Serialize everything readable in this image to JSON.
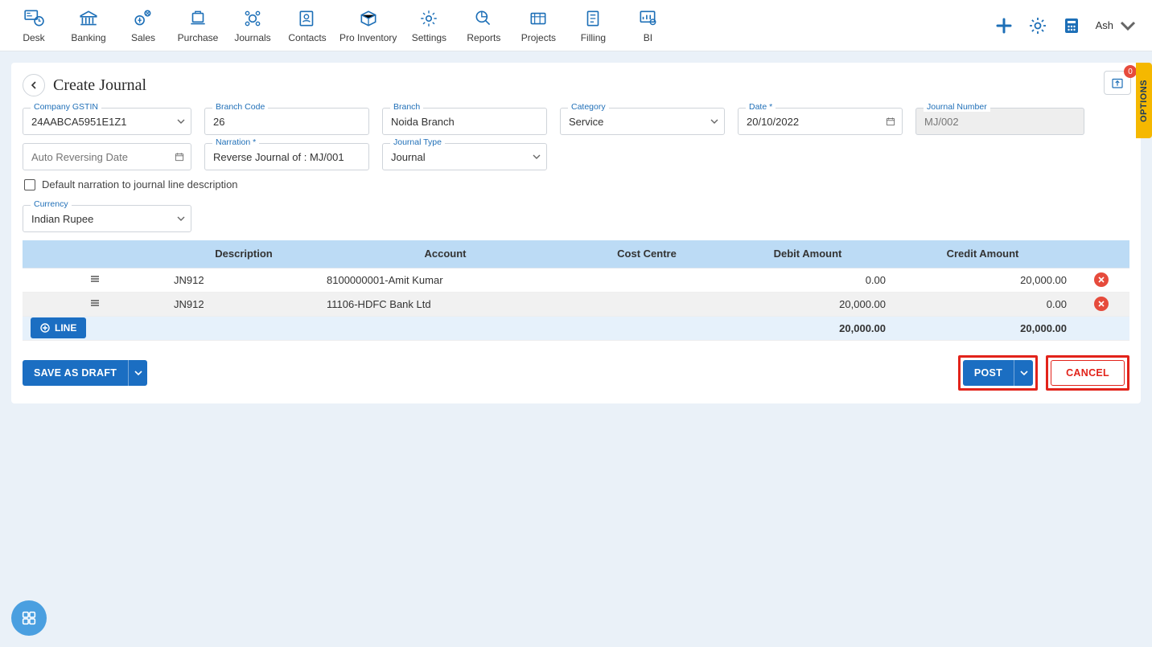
{
  "nav": {
    "items": [
      {
        "label": "Desk",
        "name": "nav-desk"
      },
      {
        "label": "Banking",
        "name": "nav-banking"
      },
      {
        "label": "Sales",
        "name": "nav-sales"
      },
      {
        "label": "Purchase",
        "name": "nav-purchase"
      },
      {
        "label": "Journals",
        "name": "nav-journals"
      },
      {
        "label": "Contacts",
        "name": "nav-contacts"
      },
      {
        "label": "Pro Inventory",
        "name": "nav-pro-inventory"
      },
      {
        "label": "Settings",
        "name": "nav-settings"
      },
      {
        "label": "Reports",
        "name": "nav-reports"
      },
      {
        "label": "Projects",
        "name": "nav-projects"
      },
      {
        "label": "Filling",
        "name": "nav-filling"
      },
      {
        "label": "BI",
        "name": "nav-bi"
      }
    ]
  },
  "user": {
    "name": "Ash"
  },
  "options_tab": "OPTIONS",
  "upload": {
    "badge": "0"
  },
  "page": {
    "title": "Create Journal"
  },
  "form": {
    "company_gstin": {
      "label": "Company GSTIN",
      "value": "24AABCA5951E1Z1"
    },
    "branch_code": {
      "label": "Branch Code",
      "value": "26"
    },
    "branch": {
      "label": "Branch",
      "value": "Noida Branch"
    },
    "category": {
      "label": "Category",
      "value": "Service"
    },
    "date": {
      "label": "Date *",
      "value": "20/10/2022"
    },
    "journal_number": {
      "label": "Journal Number",
      "value": "MJ/002"
    },
    "auto_reversing": {
      "placeholder": "Auto Reversing Date"
    },
    "narration": {
      "label": "Narration *",
      "value": "Reverse Journal of : MJ/001"
    },
    "journal_type": {
      "label": "Journal Type",
      "value": "Journal"
    },
    "default_narration_label": "Default narration to journal line description",
    "currency": {
      "label": "Currency",
      "value": "Indian Rupee"
    }
  },
  "table": {
    "headers": {
      "description": "Description",
      "account": "Account",
      "cost_centre": "Cost Centre",
      "debit": "Debit Amount",
      "credit": "Credit Amount"
    },
    "rows": [
      {
        "description": "JN912",
        "account": "8100000001-Amit Kumar",
        "cost_centre": "",
        "debit": "0.00",
        "credit": "20,000.00"
      },
      {
        "description": "JN912",
        "account": "11106-HDFC Bank Ltd",
        "cost_centre": "",
        "debit": "20,000.00",
        "credit": "0.00"
      }
    ],
    "totals": {
      "debit": "20,000.00",
      "credit": "20,000.00"
    },
    "add_line_label": "LINE"
  },
  "footer": {
    "save_draft": "SAVE AS DRAFT",
    "post": "POST",
    "cancel": "CANCEL"
  }
}
